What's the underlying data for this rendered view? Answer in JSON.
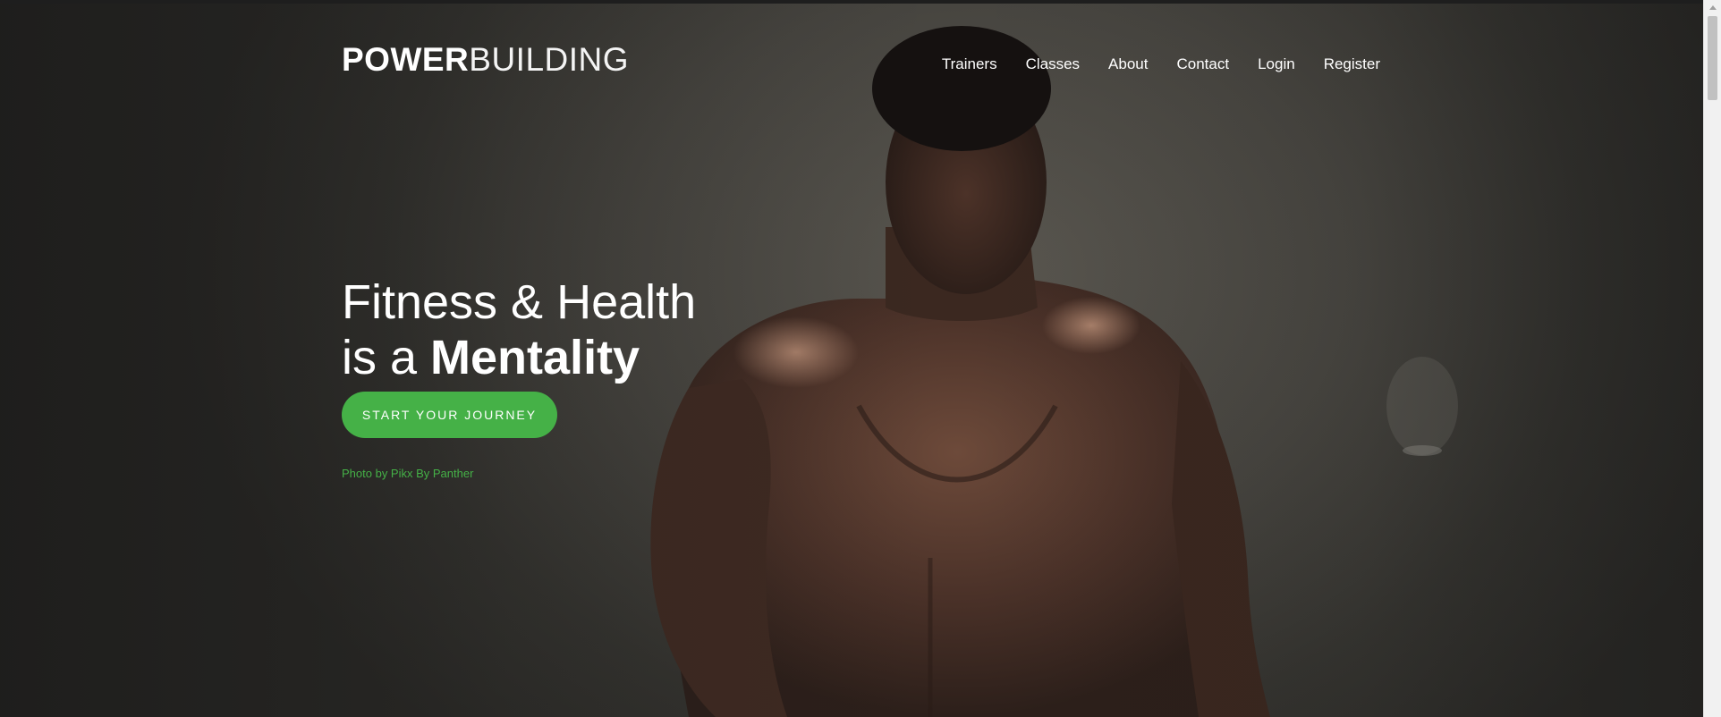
{
  "brand": {
    "strong": "POWER",
    "light": "BUILDING"
  },
  "nav": {
    "items": [
      "Trainers",
      "Classes",
      "About",
      "Contact",
      "Login",
      "Register"
    ]
  },
  "hero": {
    "line1": "Fitness & Health",
    "line2_prefix": "is a ",
    "line2_strong": "Mentality",
    "cta_label": "START YOUR JOURNEY",
    "credit": "Photo by Pikx By Panther"
  },
  "colors": {
    "accent": "#45b147",
    "text": "#ffffff"
  }
}
